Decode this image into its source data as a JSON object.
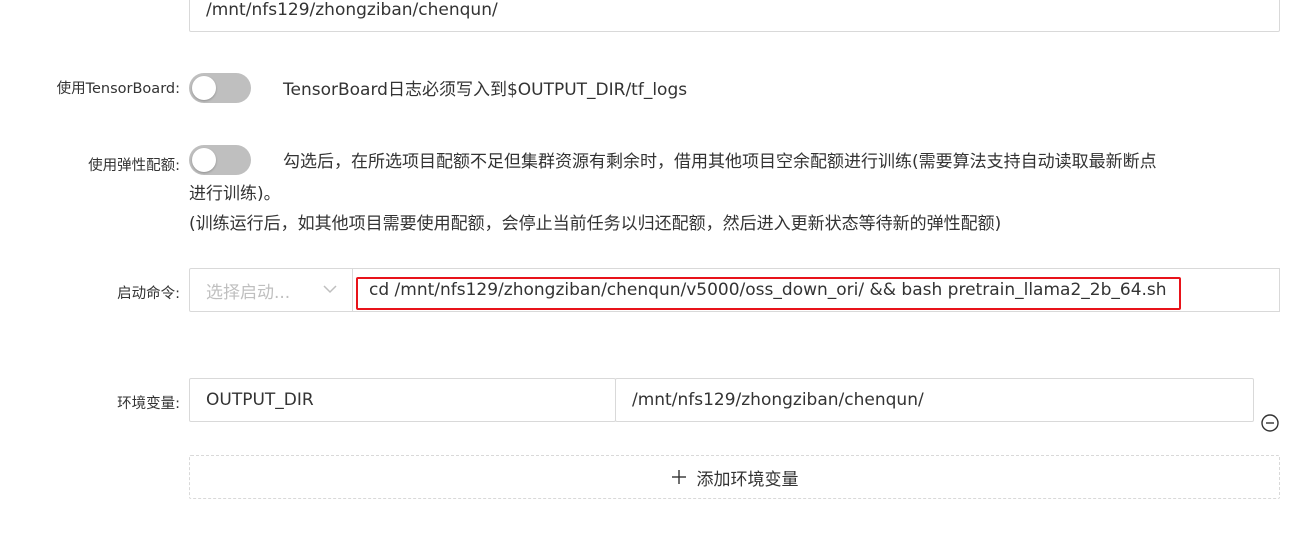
{
  "output_dir": {
    "value": "/mnt/nfs129/zhongziban/chenqun/"
  },
  "tensorboard": {
    "label": "使用TensorBoard:",
    "enabled": false,
    "hint": "TensorBoard日志必须写入到$OUTPUT_DIR/tf_logs"
  },
  "elastic_quota": {
    "label": "使用弹性配额:",
    "enabled": false,
    "hint_line1": "勾选后，在所选项目配额不足但集群资源有剩余时，借用其他项目空余配额进行训练(需要算法支持自动读取最新断点",
    "hint_line2": "进行训练)。",
    "hint_line3": "(训练运行后，如其他项目需要使用配额，会停止当前任务以归还配额，然后进入更新状态等待新的弹性配额)"
  },
  "start_command": {
    "label": "启动命令:",
    "select_placeholder": "选择启动...",
    "command": "cd /mnt/nfs129/zhongziban/chenqun/v5000/oss_down_ori/  && bash pretrain_llama2_2b_64.sh"
  },
  "env_vars": {
    "label": "环境变量:",
    "rows": [
      {
        "key": "OUTPUT_DIR",
        "value": "/mnt/nfs129/zhongziban/chenqun/"
      }
    ],
    "add_label": "添加环境变量"
  },
  "icons": {
    "remove": "minus-circle-icon",
    "add": "plus-icon",
    "dropdown": "chevron-down-icon"
  },
  "colors": {
    "highlight": "#e8131a",
    "switch_off": "#bfbfbf",
    "border": "#d9d9d9"
  }
}
